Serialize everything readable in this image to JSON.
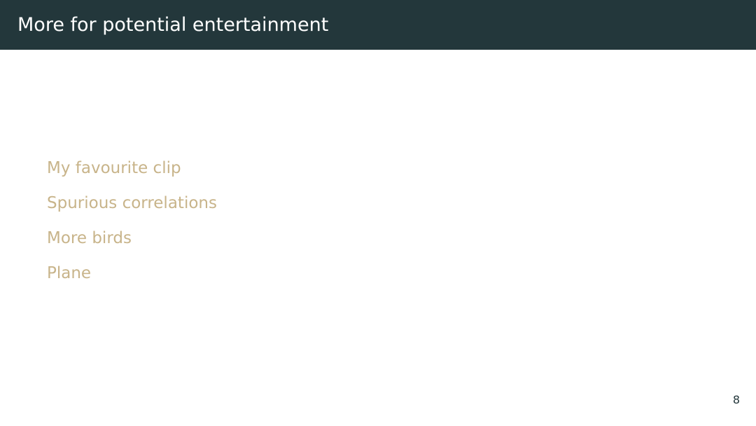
{
  "slide": {
    "title": "More for potential entertainment",
    "links": [
      {
        "label": "My favourite clip"
      },
      {
        "label": "Spurious correlations"
      },
      {
        "label": "More birds"
      },
      {
        "label": "Plane"
      }
    ],
    "page_number": "8"
  },
  "colors": {
    "title_bar": "#23373b",
    "title_text": "#ffffff",
    "link_text": "#c8b48a",
    "background": "#ffffff"
  }
}
